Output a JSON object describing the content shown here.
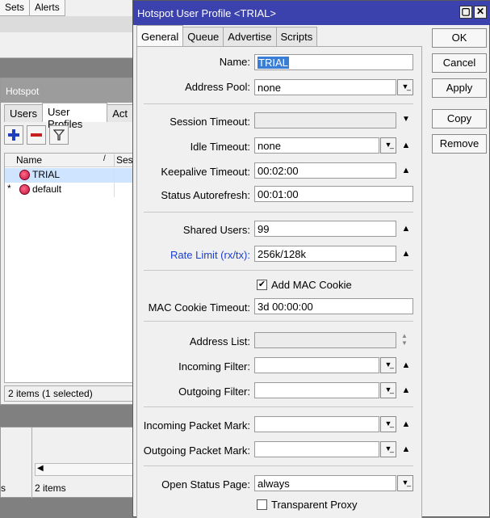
{
  "background_window": {
    "tabs": [
      "Sets",
      "Alerts"
    ]
  },
  "hotspot_window": {
    "title": "Hotspot",
    "tabs": [
      "Users",
      "User Profiles",
      "Act"
    ],
    "columns": [
      "Name",
      "Sess"
    ],
    "rows": [
      {
        "marker": "",
        "name": "TRIAL"
      },
      {
        "marker": "*",
        "name": "default"
      }
    ],
    "status": "2 items (1 selected)"
  },
  "bottom_pane": {
    "status_left": "s",
    "status_right": "2 items"
  },
  "dialog": {
    "title": "Hotspot User Profile <TRIAL>",
    "tabs": [
      "General",
      "Queue",
      "Advertise",
      "Scripts"
    ],
    "active_tab": "General",
    "fields": {
      "name_label": "Name:",
      "name_value": "TRIAL",
      "address_pool_label": "Address Pool:",
      "address_pool_value": "none",
      "session_timeout_label": "Session Timeout:",
      "session_timeout_value": "",
      "idle_timeout_label": "Idle Timeout:",
      "idle_timeout_value": "none",
      "keepalive_timeout_label": "Keepalive Timeout:",
      "keepalive_timeout_value": "00:02:00",
      "status_autorefresh_label": "Status Autorefresh:",
      "status_autorefresh_value": "00:01:00",
      "shared_users_label": "Shared Users:",
      "shared_users_value": "99",
      "rate_limit_label": "Rate Limit (rx/tx):",
      "rate_limit_value": "256k/128k",
      "add_mac_cookie_label": "Add MAC Cookie",
      "add_mac_cookie_checked": true,
      "mac_cookie_timeout_label": "MAC Cookie Timeout:",
      "mac_cookie_timeout_value": "3d 00:00:00",
      "address_list_label": "Address List:",
      "address_list_value": "",
      "incoming_filter_label": "Incoming Filter:",
      "incoming_filter_value": "",
      "outgoing_filter_label": "Outgoing Filter:",
      "outgoing_filter_value": "",
      "incoming_packet_mark_label": "Incoming Packet Mark:",
      "incoming_packet_mark_value": "",
      "outgoing_packet_mark_label": "Outgoing Packet Mark:",
      "outgoing_packet_mark_value": "",
      "open_status_page_label": "Open Status Page:",
      "open_status_page_value": "always",
      "transparent_proxy_label": "Transparent Proxy",
      "transparent_proxy_checked": false
    },
    "buttons": {
      "ok": "OK",
      "cancel": "Cancel",
      "apply": "Apply",
      "copy": "Copy",
      "remove": "Remove"
    }
  },
  "colors": {
    "title_bar": "#3b42ad",
    "rate_limit_label": "#1a3fcf",
    "selection": "#3a7dd6"
  }
}
